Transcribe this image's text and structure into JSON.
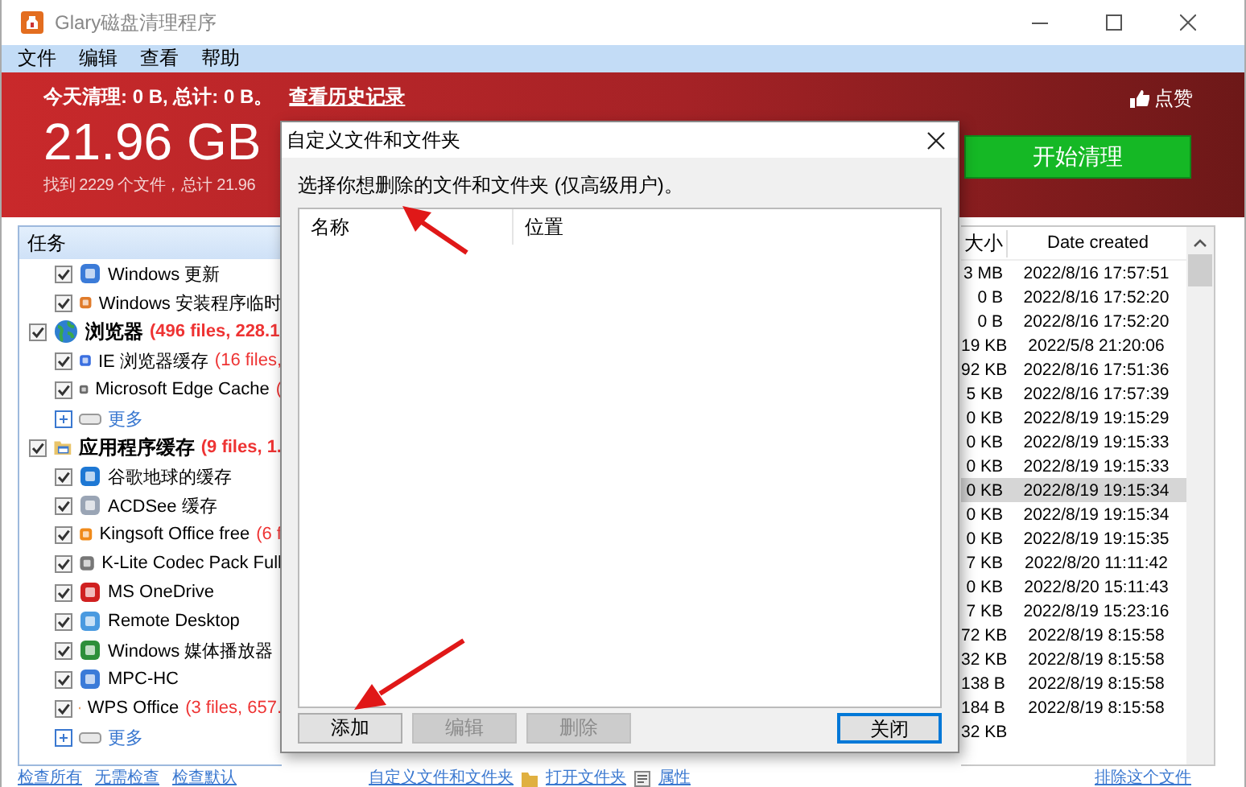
{
  "window": {
    "title": "Glary磁盘清理程序"
  },
  "menu": [
    "文件",
    "编辑",
    "查看",
    "帮助"
  ],
  "header": {
    "summary": "今天清理: 0 B, 总计: 0 B。",
    "history_link": "查看历史记录",
    "total": "21.96 GB",
    "found": "找到 2229 个文件，总计 21.96",
    "like": "点赞",
    "start_button": "开始清理"
  },
  "tasks": {
    "title": "任务",
    "items": [
      {
        "kind": "item",
        "label": "Windows 更新",
        "checked": true
      },
      {
        "kind": "item",
        "label": "Windows 安装程序临时",
        "checked": true
      },
      {
        "kind": "group",
        "label": "浏览器",
        "stats": "(496 files, 228.1",
        "checked": true,
        "children": [
          {
            "kind": "item",
            "label": "IE 浏览器缓存",
            "stats": "(16 files,",
            "checked": true
          },
          {
            "kind": "item",
            "label": "Microsoft Edge Cache",
            "stats": "(",
            "checked": true
          },
          {
            "kind": "more",
            "label": "更多"
          }
        ]
      },
      {
        "kind": "group",
        "label": "应用程序缓存",
        "stats": "(9 files, 1.",
        "checked": true,
        "children": [
          {
            "kind": "item",
            "label": "谷歌地球的缓存",
            "checked": true
          },
          {
            "kind": "item",
            "label": "ACDSee 缓存",
            "checked": true
          },
          {
            "kind": "item",
            "label": "Kingsoft Office free",
            "stats": "(6 f",
            "checked": true
          },
          {
            "kind": "item",
            "label": "K-Lite Codec Pack Full",
            "checked": true
          },
          {
            "kind": "item",
            "label": "MS OneDrive",
            "checked": true
          },
          {
            "kind": "item",
            "label": "Remote Desktop",
            "checked": true
          },
          {
            "kind": "item",
            "label": "Windows 媒体播放器",
            "checked": true
          },
          {
            "kind": "item",
            "label": "MPC-HC",
            "checked": true
          },
          {
            "kind": "item",
            "label": "WPS Office",
            "stats": "(3 files, 657.",
            "checked": true
          },
          {
            "kind": "more",
            "label": "更多"
          }
        ]
      }
    ]
  },
  "files": {
    "columns": [
      "大小",
      "Date created"
    ],
    "rows": [
      {
        "size": "3 MB",
        "date": "2022/8/16 17:57:51",
        "selected": false
      },
      {
        "size": "0 B",
        "date": "2022/8/16 17:52:20",
        "selected": false
      },
      {
        "size": "0 B",
        "date": "2022/8/16 17:52:20",
        "selected": false
      },
      {
        "size": "19 KB",
        "date": "2022/5/8 21:20:06",
        "selected": false
      },
      {
        "size": "92 KB",
        "date": "2022/8/16 17:51:36",
        "selected": false
      },
      {
        "size": "5 KB",
        "date": "2022/8/16 17:57:39",
        "selected": false
      },
      {
        "size": "0 KB",
        "date": "2022/8/19 19:15:29",
        "selected": false
      },
      {
        "size": "0 KB",
        "date": "2022/8/19 19:15:33",
        "selected": false
      },
      {
        "size": "0 KB",
        "date": "2022/8/19 19:15:33",
        "selected": false
      },
      {
        "size": "0 KB",
        "date": "2022/8/19 19:15:34",
        "selected": true
      },
      {
        "size": "0 KB",
        "date": "2022/8/19 19:15:34",
        "selected": false
      },
      {
        "size": "0 KB",
        "date": "2022/8/19 19:15:35",
        "selected": false
      },
      {
        "size": "7 KB",
        "date": "2022/8/20 11:11:42",
        "selected": false
      },
      {
        "size": "0 KB",
        "date": "2022/8/20 15:11:43",
        "selected": false
      },
      {
        "size": "7 KB",
        "date": "2022/8/19 15:23:16",
        "selected": false
      },
      {
        "size": "72 KB",
        "date": "2022/8/19 8:15:58",
        "selected": false
      },
      {
        "size": "32 KB",
        "date": "2022/8/19 8:15:58",
        "selected": false
      },
      {
        "size": "138 B",
        "date": "2022/8/19 8:15:58",
        "selected": false
      },
      {
        "size": "184 B",
        "date": "2022/8/19 8:15:58",
        "selected": false
      },
      {
        "size": "32 KB",
        "selected": false
      }
    ]
  },
  "footer": {
    "left": [
      "检查所有",
      "无需检查",
      "检查默认"
    ],
    "middle": [
      {
        "kind": "plain",
        "label": "自定义文件和文件夹"
      },
      {
        "kind": "folder",
        "label": "打开文件夹"
      },
      {
        "kind": "properties",
        "label": "属性"
      }
    ],
    "right": "排除这个文件"
  },
  "dialog": {
    "title": "自定义文件和文件夹",
    "instruction": "选择你想删除的文件和文件夹 (仅高级用户)。",
    "columns": [
      "名称",
      "位置"
    ],
    "buttons": [
      {
        "label": "添加",
        "disabled": false,
        "default": false
      },
      {
        "label": "编辑",
        "disabled": true,
        "default": false
      },
      {
        "label": "删除",
        "disabled": true,
        "default": false
      },
      {
        "label": "关闭",
        "disabled": false,
        "default": true
      }
    ]
  }
}
